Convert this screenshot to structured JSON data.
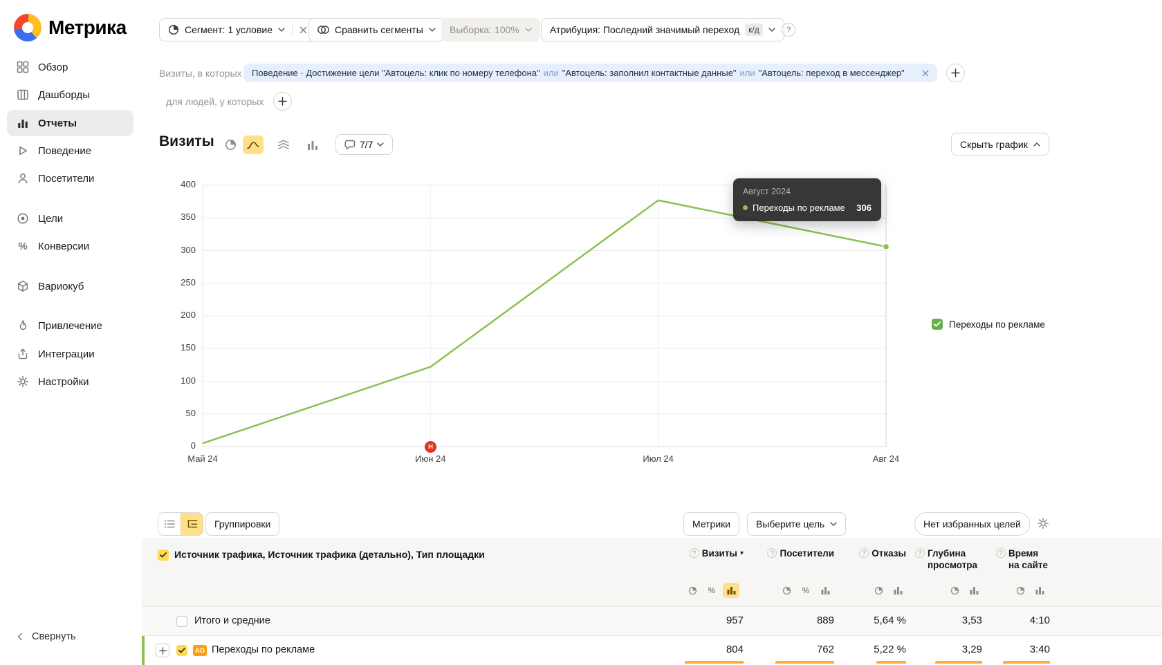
{
  "icons": {
    "percent": "%",
    "help": "?",
    "sort_desc": "▾",
    "plus": "+"
  },
  "sidebar": {
    "logo": "Метрика",
    "items": [
      {
        "label": "Обзор"
      },
      {
        "label": "Дашборды"
      },
      {
        "label": "Отчеты"
      },
      {
        "label": "Поведение"
      },
      {
        "label": "Посетители"
      },
      {
        "label": "Цели"
      },
      {
        "label": "Конверсии"
      },
      {
        "label": "Вариокуб"
      },
      {
        "label": "Привлечение"
      },
      {
        "label": "Интеграции"
      },
      {
        "label": "Настройки"
      }
    ],
    "collapse": "Свернуть"
  },
  "toolbar": {
    "segment": "Сегмент: 1 условие",
    "compare": "Сравнить сегменты",
    "sampling": "Выборка: 100%",
    "attribution": "Атрибуция: Последний значимый переход",
    "attribution_badge": "к/д"
  },
  "filter": {
    "visits_prefix": "Визиты, в которых",
    "people_prefix": "для людей, у которых",
    "condition1": "Поведение · Достижение цели \"Автоцель: клик по номеру телефона\"",
    "or1": "или",
    "condition2": "\"Автоцель: заполнил контактные данные\"",
    "or2": "или",
    "condition3": "\"Автоцель: переход в мессенджер\""
  },
  "chart_header": {
    "title": "Визиты",
    "comments": "7/7",
    "hide_chart": "Скрыть график"
  },
  "chart_data": {
    "type": "line",
    "x": [
      "Май 24",
      "Июн 24",
      "Июл 24",
      "Авг 24"
    ],
    "series": [
      {
        "name": "Переходы по рекламе",
        "color": "#8cc152",
        "values": [
          5,
          122,
          377,
          306
        ]
      }
    ],
    "ylim": [
      0,
      400
    ],
    "yticks": [
      0,
      50,
      100,
      150,
      200,
      250,
      300,
      350,
      400
    ],
    "grid": true,
    "legend_position": "right",
    "legend": [
      {
        "label": "Переходы по рекламе",
        "color": "#68b04c",
        "checked": true
      }
    ],
    "tooltip": {
      "title": "Август 2024",
      "series": "Переходы по рекламе",
      "value": "306"
    },
    "annotation_marker": "Н"
  },
  "table": {
    "groupings": "Группировки",
    "metrics": "Метрики",
    "choose_goal": "Выберите цель",
    "no_goals": "Нет избранных целей",
    "dimension_header": "Источник трафика, Источник трафика (детально), Тип площадки",
    "columns": [
      {
        "label": "Визиты"
      },
      {
        "label": "Посетители"
      },
      {
        "label": "Отказы"
      },
      {
        "label": "Глубина просмотра"
      },
      {
        "label": "Время на сайте"
      }
    ],
    "totals": {
      "label": "Итого и средние",
      "values": [
        "957",
        "889",
        "5,64 %",
        "3,53",
        "4:10"
      ]
    },
    "rows": [
      {
        "badge": "AD",
        "label": "Переходы по рекламе",
        "values": [
          "804",
          "762",
          "5,22 %",
          "3,29",
          "3:40"
        ]
      }
    ]
  }
}
